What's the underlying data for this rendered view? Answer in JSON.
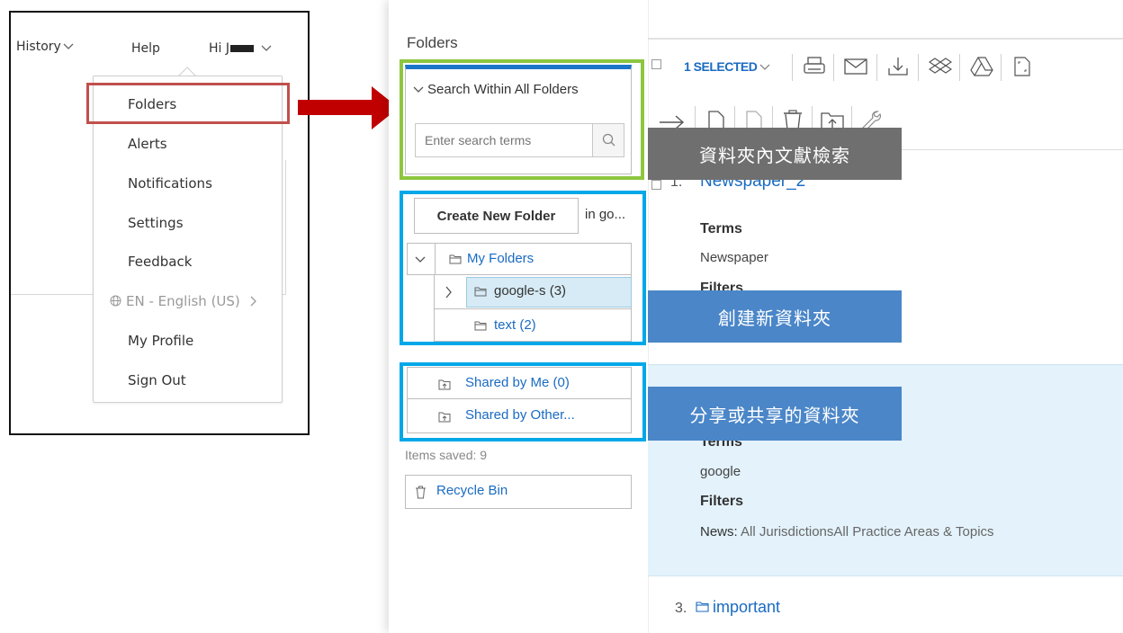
{
  "left_panel": {
    "nav": {
      "history": "History",
      "help": "Help",
      "greeting": "Hi J"
    },
    "menu": {
      "folders": "Folders",
      "alerts": "Alerts",
      "notifications": "Notifications",
      "settings": "Settings",
      "feedback": "Feedback",
      "language": "EN - English (US)",
      "my_profile": "My Profile",
      "sign_out": "Sign Out"
    }
  },
  "right_panel": {
    "folders_heading": "Folders",
    "search": {
      "header": "Search Within All Folders",
      "placeholder": "Enter search terms"
    },
    "create": {
      "button": "Create New Folder",
      "in_label": "in go..."
    },
    "tree": {
      "my_folders": "My Folders",
      "google": "google-s (3)",
      "text": "text (2)",
      "shared_by_me": "Shared by Me (0)",
      "shared_by_others": "Shared by Other..."
    },
    "items_saved": "Items saved: 9",
    "recycle_bin": "Recycle Bin",
    "toolbar": {
      "selected": "1 SELECTED"
    },
    "results": {
      "r1_number": "1.",
      "r1_title": "Newspaper_2",
      "r1_terms_label": "Terms",
      "r1_terms_value": "Newspaper",
      "r1_filters_label": "Filters",
      "r2_terms_label": "Terms",
      "r2_terms_value": "google",
      "r2_filters_label": "Filters",
      "r2_filters_prefix": "News:",
      "r2_filters_value": " All JurisdictionsAll Practice Areas & Topics",
      "r3_number": "3.",
      "r3_title": "important"
    }
  },
  "callouts": {
    "search": "資料夾內文獻檢索",
    "create": "創建新資料夾",
    "shared": "分享或共享的資料夾"
  },
  "colors": {
    "highlight_red": "#c0504d",
    "arrow_red": "#c00000",
    "outline_green": "#8dc63f",
    "outline_blue": "#00a8e8",
    "link_blue": "#1a6bc2",
    "callout_gray": "#6f6f6f",
    "callout_blue": "#4a86c8"
  }
}
